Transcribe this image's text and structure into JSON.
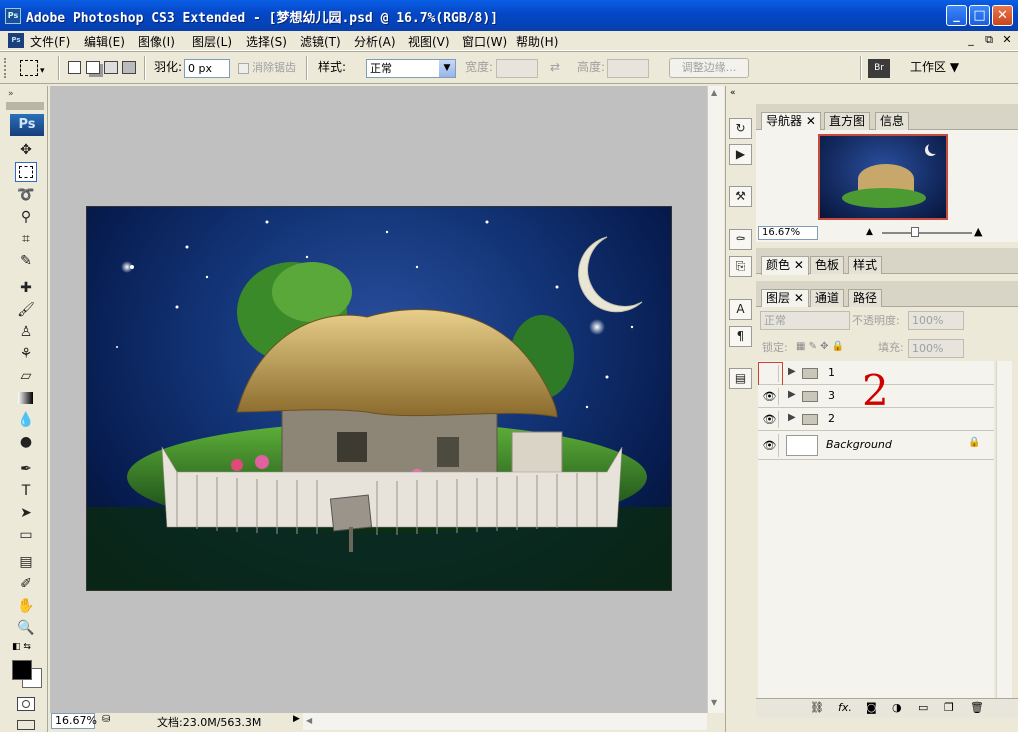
{
  "title": {
    "text": "Adobe Photoshop CS3 Extended - [梦想幼儿园.psd @ 16.7%(RGB/8)]",
    "ps_icon": "Ps"
  },
  "window_buttons": {
    "minimize": "_",
    "maximize": "□",
    "close": "✕"
  },
  "menu": {
    "items": [
      "文件(F)",
      "编辑(E)",
      "图像(I)",
      "图层(L)",
      "选择(S)",
      "滤镜(T)",
      "分析(A)",
      "视图(V)",
      "窗口(W)",
      "帮助(H)"
    ],
    "restore_buttons": [
      "_",
      "⧉",
      "✕"
    ]
  },
  "options": {
    "feather_label": "羽化:",
    "feather_value": "0 px",
    "antialias_label": "消除锯齿",
    "style_label": "样式:",
    "style_value": "正常",
    "width_label": "宽度:",
    "height_label": "高度:",
    "refine_label": "调整边缘...",
    "workspace_label": "工作区 ▼"
  },
  "tools": {
    "logo": "Ps"
  },
  "status": {
    "zoom": "16.67%",
    "doc": "文档:23.0M/563.3M"
  },
  "navigator": {
    "tabs": [
      "导航器",
      "直方图",
      "信息"
    ],
    "zoom": "16.67%"
  },
  "color_panel": {
    "tabs": [
      "颜色",
      "色板",
      "样式"
    ]
  },
  "layers": {
    "tabs": [
      "图层",
      "通道",
      "路径"
    ],
    "blend_mode": "正常",
    "opacity_label": "不透明度:",
    "opacity_value": "100%",
    "lock_label": "锁定:",
    "fill_label": "填充:",
    "fill_value": "100%",
    "items": [
      {
        "name": "1",
        "visible": false,
        "type": "group"
      },
      {
        "name": "3",
        "visible": true,
        "type": "group"
      },
      {
        "name": "2",
        "visible": true,
        "type": "group"
      },
      {
        "name": "Background",
        "visible": true,
        "type": "background"
      }
    ],
    "annotation": "2",
    "footer_fx": "fx."
  },
  "colors": {
    "accent": "#0548c8",
    "annotation_red": "#d00000"
  }
}
